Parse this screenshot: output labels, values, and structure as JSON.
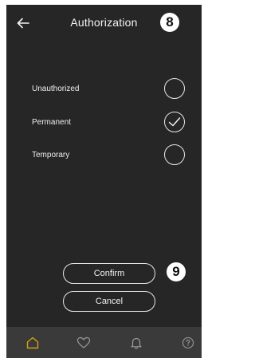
{
  "header": {
    "title": "Authorization",
    "back_icon": "arrow-left-icon",
    "step_badge": "8"
  },
  "options": [
    {
      "label": "Unauthorized",
      "selected": false
    },
    {
      "label": "Permanent",
      "selected": true
    },
    {
      "label": "Temporary",
      "selected": false
    }
  ],
  "actions": {
    "confirm_label": "Confirm",
    "cancel_label": "Cancel",
    "step_badge": "9"
  },
  "bottom_nav": {
    "items": [
      {
        "icon": "home-icon",
        "active": true
      },
      {
        "icon": "heart-icon",
        "active": false
      },
      {
        "icon": "bell-icon",
        "active": false
      },
      {
        "icon": "help-icon",
        "active": false
      }
    ]
  },
  "colors": {
    "background": "#262626",
    "nav_background": "#3a3a3a",
    "accent": "#d4a017",
    "text": "#f2f2f2",
    "muted_icon": "#9a9a9a"
  }
}
